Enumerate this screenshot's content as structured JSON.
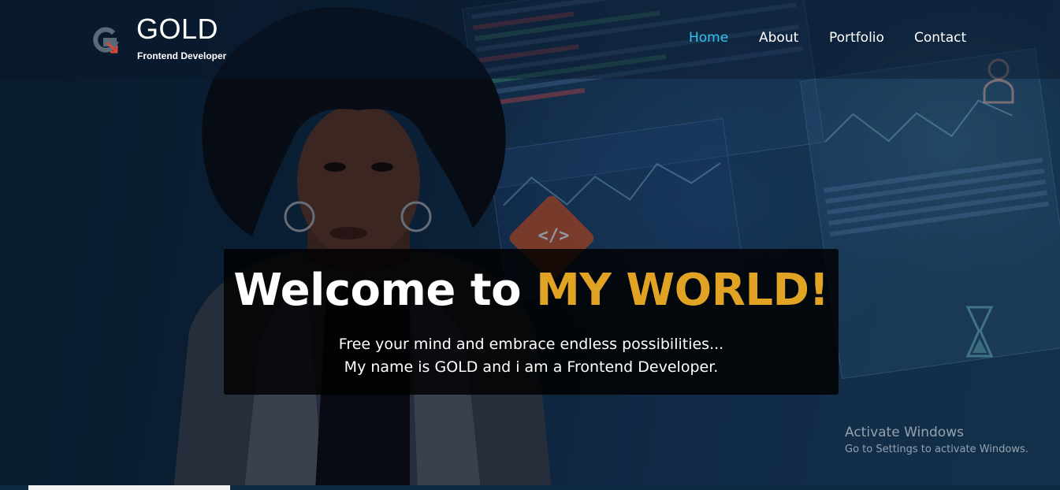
{
  "brand": {
    "name": "GOLD",
    "subtitle": "Frontend Developer",
    "logo_icon": "g-logo-icon"
  },
  "nav": {
    "items": [
      {
        "label": "Home",
        "active": true
      },
      {
        "label": "About",
        "active": false
      },
      {
        "label": "Portfolio",
        "active": false
      },
      {
        "label": "Contact",
        "active": false
      }
    ],
    "active_color": "#2ec4f0"
  },
  "hero": {
    "title_main": "Welcome to",
    "title_accent": "MY WORLD!",
    "accent_color": "#e0a324",
    "tagline_line1": "Free your mind and embrace endless possibilities...",
    "tagline_line2": "My name is GOLD and i am a Frontend Developer."
  },
  "decor": {
    "badge_text": "</>",
    "icons": [
      "code-badge-icon",
      "person-icon",
      "hourglass-icon"
    ]
  },
  "watermark": {
    "line1": "Activate Windows",
    "line2": "Go to Settings to activate Windows."
  }
}
